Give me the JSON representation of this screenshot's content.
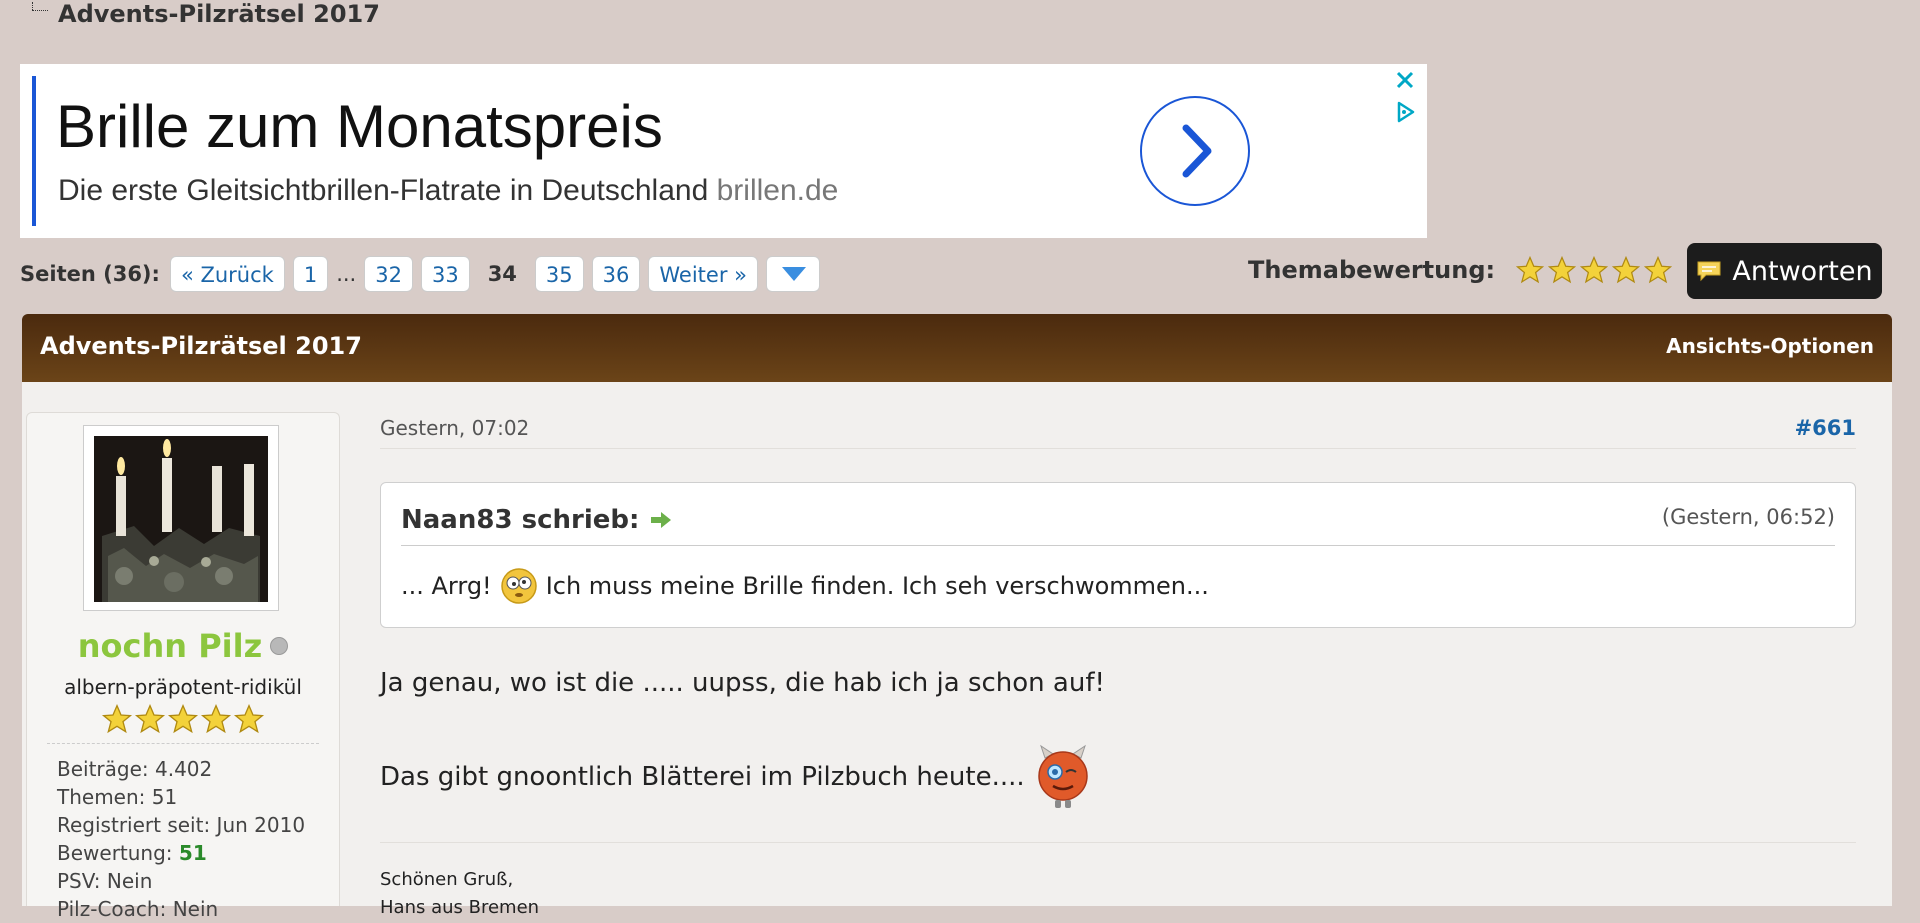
{
  "breadcrumb": {
    "title": "Advents-Pilzrätsel 2017"
  },
  "ad": {
    "headline": "Brille zum Monatspreis",
    "subline": "Die erste Gleitsichtbrillen-Flatrate in Deutschland",
    "domain": "brillen.de",
    "accent_color": "#1a56d6",
    "icons": [
      "chevron-right-icon",
      "close-icon",
      "adchoices-icon"
    ]
  },
  "pagination": {
    "label": "Seiten (36):",
    "prev": "« Zurück",
    "first": "1",
    "ellipsis": "...",
    "p32": "32",
    "p33": "33",
    "current": "34",
    "p35": "35",
    "p36": "36",
    "next": "Weiter »"
  },
  "rating": {
    "label": "Themabewertung:",
    "stars": 5
  },
  "reply": {
    "label": "Antworten"
  },
  "thread": {
    "title": "Advents-Pilzrätsel 2017",
    "view_options": "Ansichts-Optionen",
    "header_color": "#4b2a0e"
  },
  "user": {
    "name": "nochn Pilz",
    "name_color": "#8cc63e",
    "title": "albern-präpotent-ridikül",
    "stars": 5,
    "posts_label": "Beiträge:",
    "posts": "4.402",
    "threads_label": "Themen:",
    "threads": "51",
    "registered_label": "Registriert seit:",
    "registered": "Jun 2010",
    "reputation_label": "Bewertung:",
    "reputation": "51",
    "psv_label": "PSV:",
    "psv": "Nein",
    "extra_label": "Pilz-Coach:",
    "extra": "Nein"
  },
  "post": {
    "date": "Gestern, 07:02",
    "number": "#661",
    "quote_author": "Naan83 schrieb:",
    "quote_time": "(Gestern, 06:52)",
    "quote_text_a": "... Arrg!",
    "quote_text_b": "Ich muss meine Brille finden. Ich seh verschwommen...",
    "line1": "Ja genau, wo ist die ..... uupss, die hab ich ja schon auf!",
    "line2": "Das gibt gnoontlich Blätterei im Pilzbuch heute....",
    "sig1": "Schönen Gruß,",
    "sig2": "Hans aus Bremen"
  }
}
